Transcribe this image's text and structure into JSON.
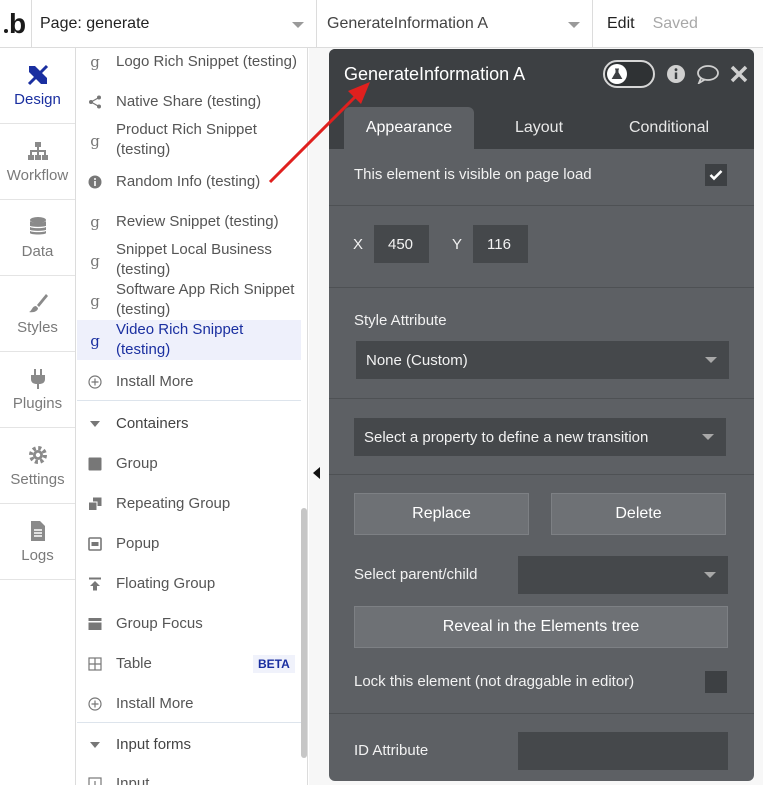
{
  "topbar": {
    "logo": "b",
    "page_label": "Page: generate",
    "element_label": "GenerateInformation A",
    "edit_label": "Edit",
    "saved_label": "Saved"
  },
  "nav": [
    {
      "label": "Design",
      "icon": "design-icon"
    },
    {
      "label": "Workflow",
      "icon": "workflow-icon"
    },
    {
      "label": "Data",
      "icon": "database-icon"
    },
    {
      "label": "Styles",
      "icon": "brush-icon"
    },
    {
      "label": "Plugins",
      "icon": "plug-icon"
    },
    {
      "label": "Settings",
      "icon": "gear-icon"
    },
    {
      "label": "Logs",
      "icon": "document-icon"
    }
  ],
  "palette": {
    "items": [
      {
        "label": "Logo Rich Snippet (testing)",
        "icon": "g"
      },
      {
        "label": "Native Share (testing)",
        "icon": "share"
      },
      {
        "label": "Product Rich Snippet (testing)",
        "icon": "g"
      },
      {
        "label": "Random Info (testing)",
        "icon": "info"
      },
      {
        "label": "Review Snippet (testing)",
        "icon": "g"
      },
      {
        "label": "Snippet Local Business (testing)",
        "icon": "g"
      },
      {
        "label": "Software App Rich Snippet (testing)",
        "icon": "g"
      },
      {
        "label": "Video Rich Snippet (testing)",
        "icon": "g"
      }
    ],
    "install_more": "Install More",
    "containers_head": "Containers",
    "containers": [
      {
        "label": "Group",
        "icon": "group-icon"
      },
      {
        "label": "Repeating Group",
        "icon": "repeating-group-icon"
      },
      {
        "label": "Popup",
        "icon": "popup-icon"
      },
      {
        "label": "Floating Group",
        "icon": "floating-group-icon"
      },
      {
        "label": "Group Focus",
        "icon": "group-focus-icon"
      },
      {
        "label": "Table",
        "icon": "table-icon"
      }
    ],
    "beta": "BETA",
    "install_more_2": "Install More",
    "input_forms_head": "Input forms",
    "input_item": "Input"
  },
  "editor": {
    "title": "GenerateInformation A",
    "tabs": [
      "Appearance",
      "Layout",
      "Conditional"
    ],
    "visible_label": "This element is visible on page load",
    "x_label": "X",
    "x_value": "450",
    "y_label": "Y",
    "y_value": "116",
    "style_attr_label": "Style Attribute",
    "style_value": "None (Custom)",
    "transition_placeholder": "Select a property to define a new transition",
    "replace": "Replace",
    "delete": "Delete",
    "parent_child_label": "Select parent/child",
    "reveal": "Reveal in the Elements tree",
    "lock_label": "Lock this element (not draggable in editor)",
    "id_attr_label": "ID Attribute"
  },
  "colors": {
    "accent": "#1a2fa0",
    "panel": "#5d6064",
    "panel_header": "#3d4043",
    "arrow": "#e0201e"
  }
}
